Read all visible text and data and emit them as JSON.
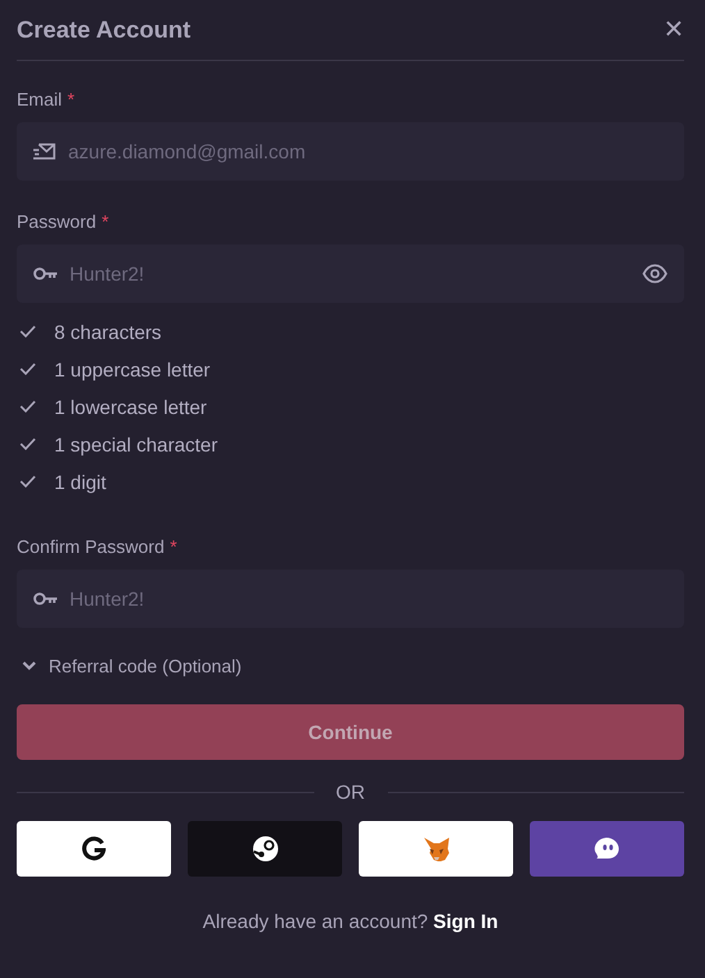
{
  "dialog": {
    "title": "Create Account",
    "close_glyph": "✕"
  },
  "fields": [
    {
      "kind": "email",
      "label": "Email",
      "required_mark": "*",
      "placeholder": "azure.diamond@gmail.com",
      "reveal": false
    },
    {
      "kind": "password",
      "label": "Password",
      "required_mark": "*",
      "placeholder": "Hunter2!",
      "reveal": true
    }
  ],
  "requirements": [
    {
      "text": "8 characters",
      "checked": true
    },
    {
      "text": "1 uppercase letter",
      "checked": true
    },
    {
      "text": "1 lowercase letter",
      "checked": true
    },
    {
      "text": "1 special character",
      "checked": true
    },
    {
      "text": "1 digit",
      "checked": true
    }
  ],
  "confirm_field": {
    "kind": "password",
    "label": "Confirm Password",
    "required_mark": "*",
    "placeholder": "Hunter2!",
    "reveal": false
  },
  "referral": {
    "label": "Referral code (Optional)",
    "expanded": false
  },
  "continue_button": {
    "label": "Continue",
    "disabled": true
  },
  "divider": {
    "label": "OR"
  },
  "social_buttons": [
    {
      "kind": "google"
    },
    {
      "kind": "steam"
    },
    {
      "kind": "fox"
    },
    {
      "kind": "ghost"
    }
  ],
  "footer": {
    "text": "Already have an account?",
    "link": "Sign In"
  }
}
